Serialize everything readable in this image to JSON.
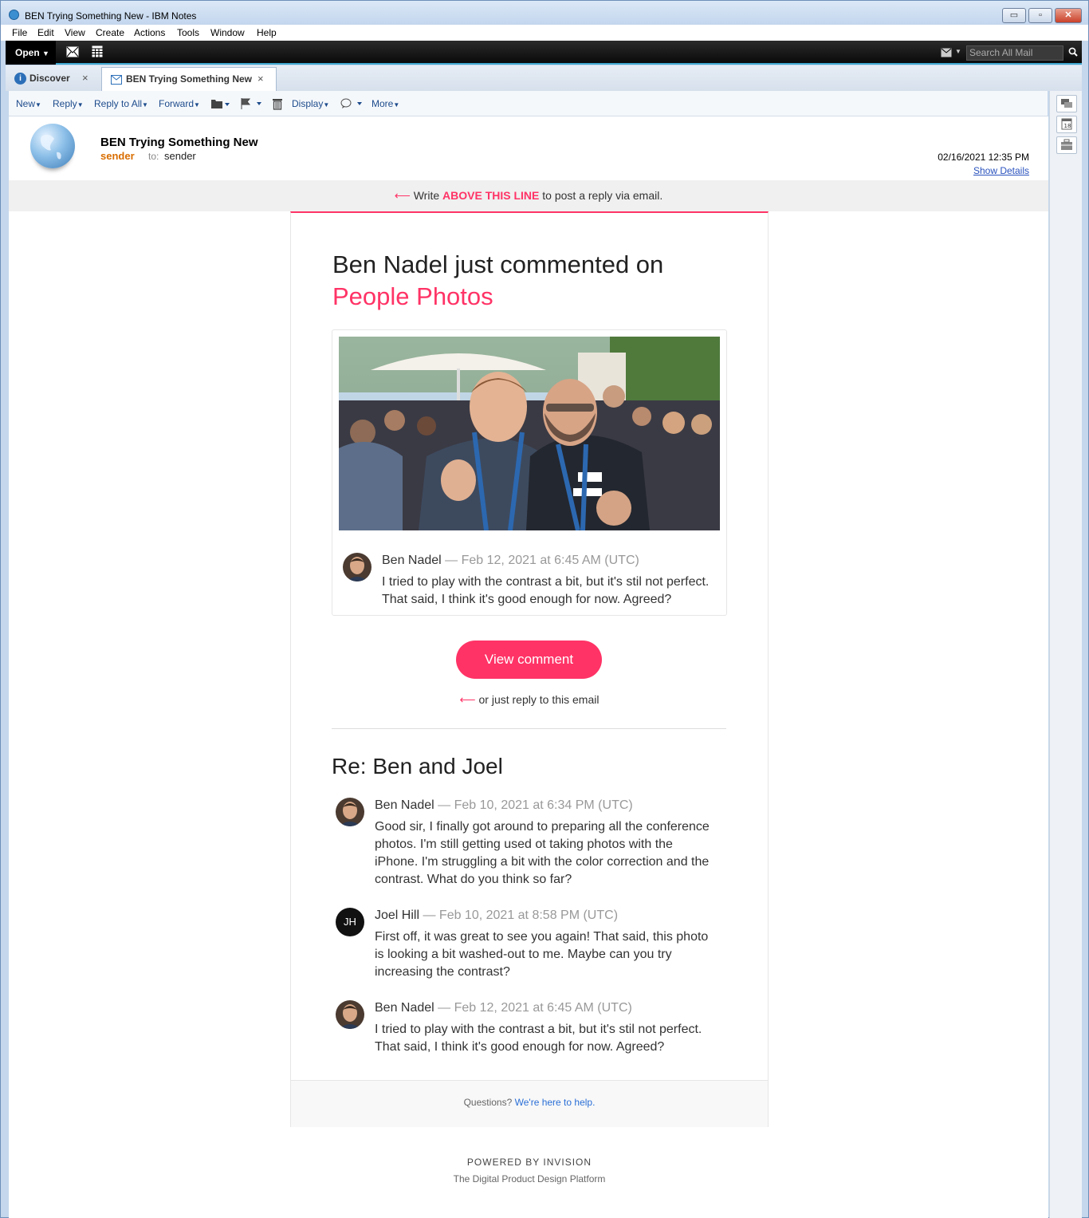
{
  "window": {
    "title": "BEN Trying Something New - IBM Notes",
    "minimize": "▭",
    "restore": "▫",
    "close": "✕"
  },
  "menu": [
    "File",
    "Edit",
    "View",
    "Create",
    "Actions",
    "Tools",
    "Window",
    "Help"
  ],
  "toolbar": {
    "open_label": "Open",
    "search_placeholder": "Search All Mail"
  },
  "tabs": [
    {
      "label": "Discover",
      "icon": "info-icon"
    },
    {
      "label": "BEN Trying Something New",
      "icon": "mail-icon"
    }
  ],
  "actions": {
    "new": "New",
    "reply": "Reply",
    "reply_all": "Reply to All",
    "forward": "Forward",
    "display": "Display",
    "more": "More"
  },
  "header": {
    "subject": "BEN Trying Something New",
    "sender": "sender",
    "to_label": "to:",
    "to_value": "sender",
    "date": "02/16/2021 12:35 PM",
    "show_details": "Show Details"
  },
  "reply_line": {
    "arrow": "⟵",
    "pre": "Write",
    "highlight": "ABOVE THIS LINE",
    "post": "to post a reply via email."
  },
  "email": {
    "headline_1": "Ben Nadel just commented on",
    "headline_2": "People Photos",
    "featured_comment": {
      "author": "Ben Nadel",
      "meta": "— Feb 12, 2021 at 6:45 AM (UTC)",
      "text_1": "I tried to play with the contrast a bit, but it's stil not perfect.",
      "text_2": "That said, I think it's good enough for now. Agreed?"
    },
    "view_button": "View comment",
    "just_reply": "or just reply to this email",
    "thread_title": "Re: Ben and Joel",
    "thread": [
      {
        "author": "Ben Nadel",
        "meta": "— Feb 10, 2021 at 6:34 PM (UTC)",
        "lines": [
          "Good sir, I finally got around to preparing all the conference",
          "photos. I'm still getting used ot taking photos with the",
          "iPhone. I'm struggling a bit with the color correction and the",
          "contrast. What do you think so far?"
        ]
      },
      {
        "author": "Joel Hill",
        "initials": "JH",
        "meta": "— Feb 10, 2021 at 8:58 PM (UTC)",
        "lines": [
          "First off, it was great to see you again! That said, this photo",
          "is looking a bit washed-out to me. Maybe can you try",
          "increasing the contrast?"
        ]
      },
      {
        "author": "Ben Nadel",
        "meta": "— Feb 12, 2021 at 6:45 AM (UTC)",
        "lines": [
          "I tried to play with the contrast a bit, but it's stil not perfect.",
          "That said, I think it's good enough for now. Agreed?"
        ]
      }
    ],
    "footer_text": "Questions?",
    "footer_link": "We're here to help.",
    "powered_by": "POWERED BY INVISION",
    "platform": "The Digital Product Design Platform"
  },
  "colors": {
    "accent": "#ff3366",
    "sender": "#d96d00",
    "link": "#2a52be"
  }
}
